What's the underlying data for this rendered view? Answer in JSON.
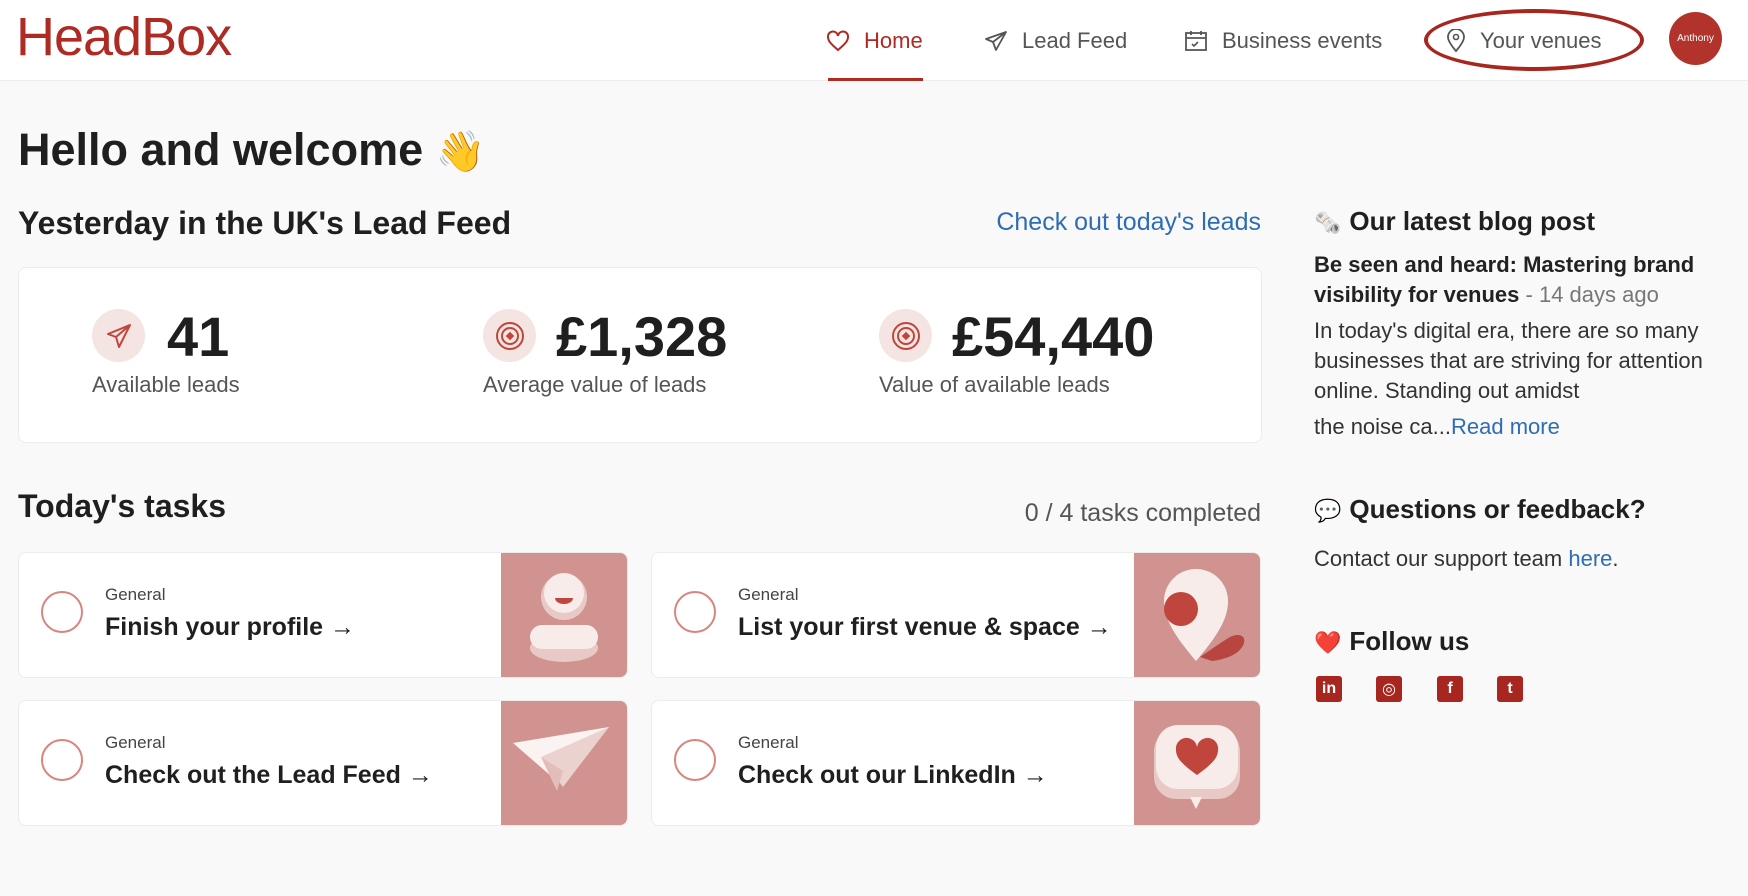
{
  "header": {
    "logo": "HeadBox",
    "nav": {
      "home": "Home",
      "lead_feed": "Lead Feed",
      "business_events": "Business events",
      "your_venues": "Your venues"
    },
    "avatar_name": "Anthony"
  },
  "main": {
    "greeting": "Hello and welcome",
    "greeting_emoji": "👋",
    "lead_feed": {
      "title": "Yesterday in the UK's Lead Feed",
      "link": "Check out today's leads",
      "stats": [
        {
          "value": "41",
          "label": "Available leads",
          "icon": "paper-plane-icon"
        },
        {
          "value": "£1,328",
          "label": "Average value of leads",
          "icon": "target-icon"
        },
        {
          "value": "£54,440",
          "label": "Value of available leads",
          "icon": "target-icon"
        }
      ]
    },
    "tasks": {
      "title": "Today's tasks",
      "completed": "0 / 4 tasks completed",
      "items": [
        {
          "category": "General",
          "name": "Finish your profile →",
          "art": "profile-illustration"
        },
        {
          "category": "General",
          "name": "List your first venue & space →",
          "art": "location-pin-illustration"
        },
        {
          "category": "General",
          "name": "Check out the Lead Feed →",
          "art": "paper-plane-illustration"
        },
        {
          "category": "General",
          "name": "Check out our LinkedIn →",
          "art": "heart-bubble-illustration"
        }
      ]
    }
  },
  "sidebar": {
    "blog": {
      "emoji": "🗞️",
      "heading": "Our latest blog post",
      "post_title": "Be seen and heard: Mastering brand visibility for venues",
      "post_age": "- 14 days ago",
      "excerpt": "In today's digital era, there are so many businesses that are striving for attention online. Standing out amidst",
      "excerpt_end": "the noise ca...",
      "read_more": "Read more"
    },
    "feedback": {
      "emoji": "💬",
      "heading": "Questions or feedback?",
      "text": "Contact our support team",
      "link": "here",
      "suffix": "."
    },
    "follow": {
      "emoji": "❤️",
      "heading": "Follow us",
      "networks": [
        {
          "name": "linkedin-icon",
          "glyph": "in"
        },
        {
          "name": "instagram-icon",
          "glyph": "◎"
        },
        {
          "name": "facebook-icon",
          "glyph": "f"
        },
        {
          "name": "twitter-icon",
          "glyph": "t"
        }
      ]
    }
  },
  "colors": {
    "brand": "#ad2b23",
    "link": "#2e6db4",
    "tile": "#d09390"
  }
}
